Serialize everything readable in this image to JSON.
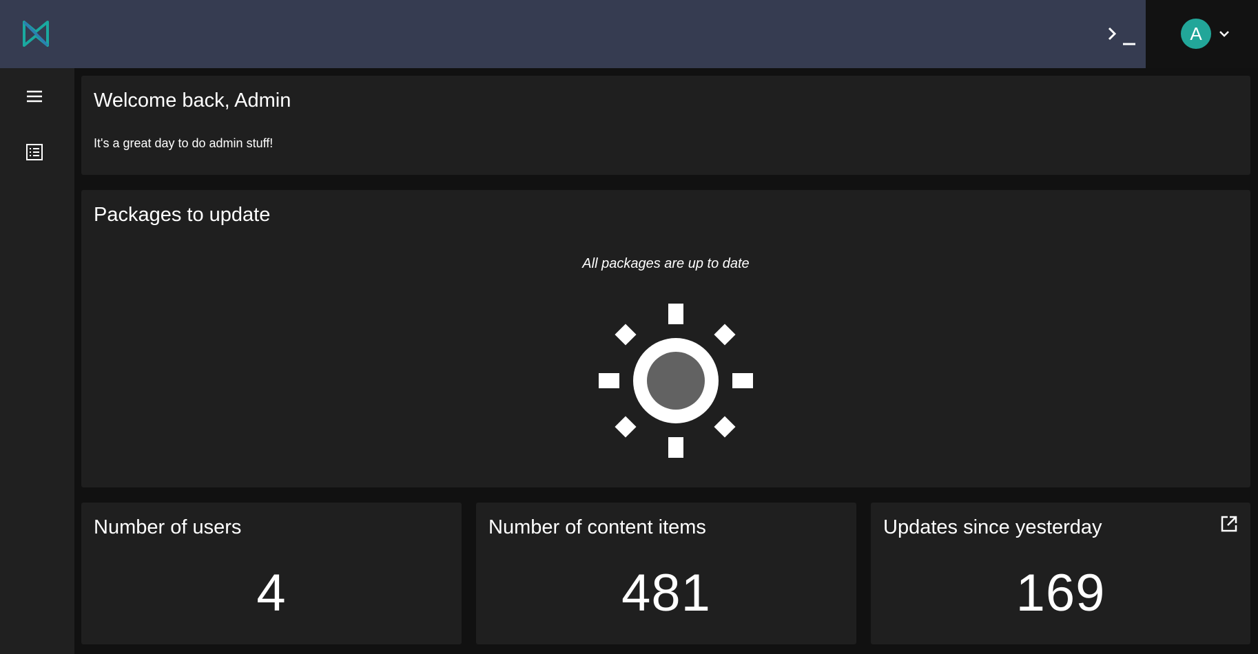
{
  "colors": {
    "topbar": "#363c51",
    "accent": "#22a699",
    "card": "#1f1f1f",
    "background": "#111111"
  },
  "header": {
    "logo_icon": "brand-logo-icon",
    "terminal_icon": "terminal-icon",
    "user": {
      "avatar_initial": "A",
      "menu_icon": "chevron-down-icon"
    }
  },
  "sidebar": {
    "items": [
      {
        "icon": "menu-icon"
      },
      {
        "icon": "list-icon"
      }
    ]
  },
  "welcome": {
    "title": "Welcome back, Admin",
    "subtitle": "It's a great day to do admin stuff!"
  },
  "packages": {
    "title": "Packages to update",
    "empty_message": "All packages are up to date",
    "empty_icon": "sun-icon"
  },
  "stats": [
    {
      "label": "Number of users",
      "value": "4"
    },
    {
      "label": "Number of content items",
      "value": "481"
    },
    {
      "label": "Updates since yesterday",
      "value": "169",
      "link_icon": "open-external-icon"
    }
  ]
}
